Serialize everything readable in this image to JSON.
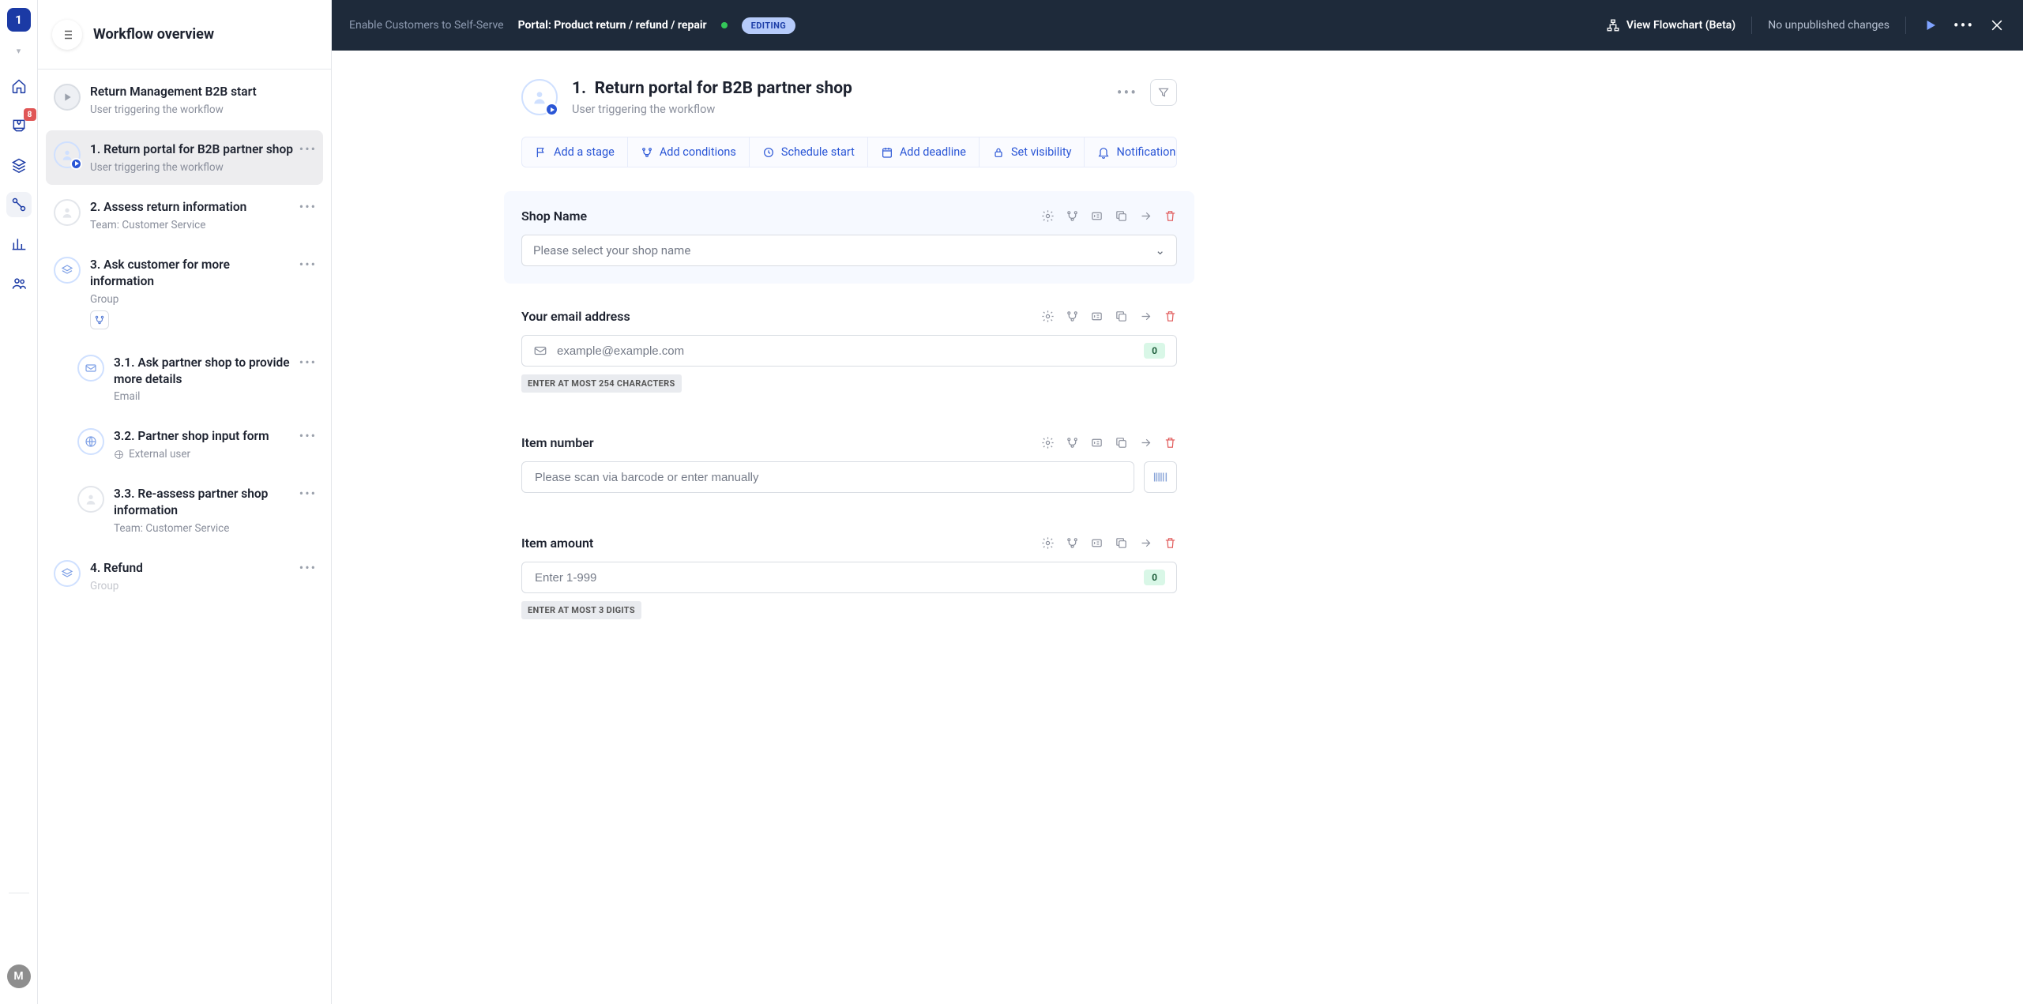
{
  "rail": {
    "logo": "1",
    "inbox_badge": "8",
    "avatar": "M"
  },
  "sidebar": {
    "title": "Workflow overview",
    "steps": [
      {
        "title": "Return Management B2B start",
        "sub": "User triggering the workflow",
        "type": "start"
      },
      {
        "title": "1. Return portal for B2B partner shop",
        "sub": "User triggering the workflow",
        "type": "user-play",
        "selected": true
      },
      {
        "title": "2. Assess return information",
        "sub": "Team: Customer Service",
        "type": "user"
      },
      {
        "title": "3. Ask customer for more information",
        "sub": "Group",
        "type": "group",
        "branch": true
      },
      {
        "title": "3.1. Ask partner shop to provide more details",
        "sub": "Email",
        "type": "mail",
        "nested": true
      },
      {
        "title": "3.2. Partner shop input form",
        "sub": "External user",
        "type": "external",
        "nested": true
      },
      {
        "title": "3.3. Re-assess partner shop information",
        "sub": "Team: Customer Service",
        "type": "user",
        "nested": true
      },
      {
        "title": "4. Refund",
        "sub": "Group",
        "type": "group"
      }
    ]
  },
  "topbar": {
    "crumb": "Enable Customers to Self-Serve",
    "portal": "Portal: Product return / refund / repair",
    "chip": "EDITING",
    "view_flowchart": "View Flowchart (Beta)",
    "msg": "No unpublished changes"
  },
  "main": {
    "prefix": "1.",
    "title": "Return portal for B2B partner shop",
    "sub": "User triggering the workflow",
    "toolbar": {
      "stage": "Add a stage",
      "conditions": "Add conditions",
      "schedule": "Schedule start",
      "deadline": "Add deadline",
      "visibility": "Set visibility",
      "notifications": "Notifications"
    },
    "fields": [
      {
        "label": "Shop Name",
        "kind": "select",
        "placeholder": "Please select your shop name"
      },
      {
        "label": "Your email address",
        "kind": "email",
        "placeholder": "example@example.com",
        "count": "0",
        "hint": "ENTER AT MOST 254 CHARACTERS"
      },
      {
        "label": "Item number",
        "kind": "barcode",
        "placeholder": "Please scan via barcode or enter manually"
      },
      {
        "label": "Item amount",
        "kind": "number",
        "placeholder": "Enter 1-999",
        "count": "0",
        "hint": "ENTER AT MOST 3 DIGITS"
      }
    ]
  }
}
